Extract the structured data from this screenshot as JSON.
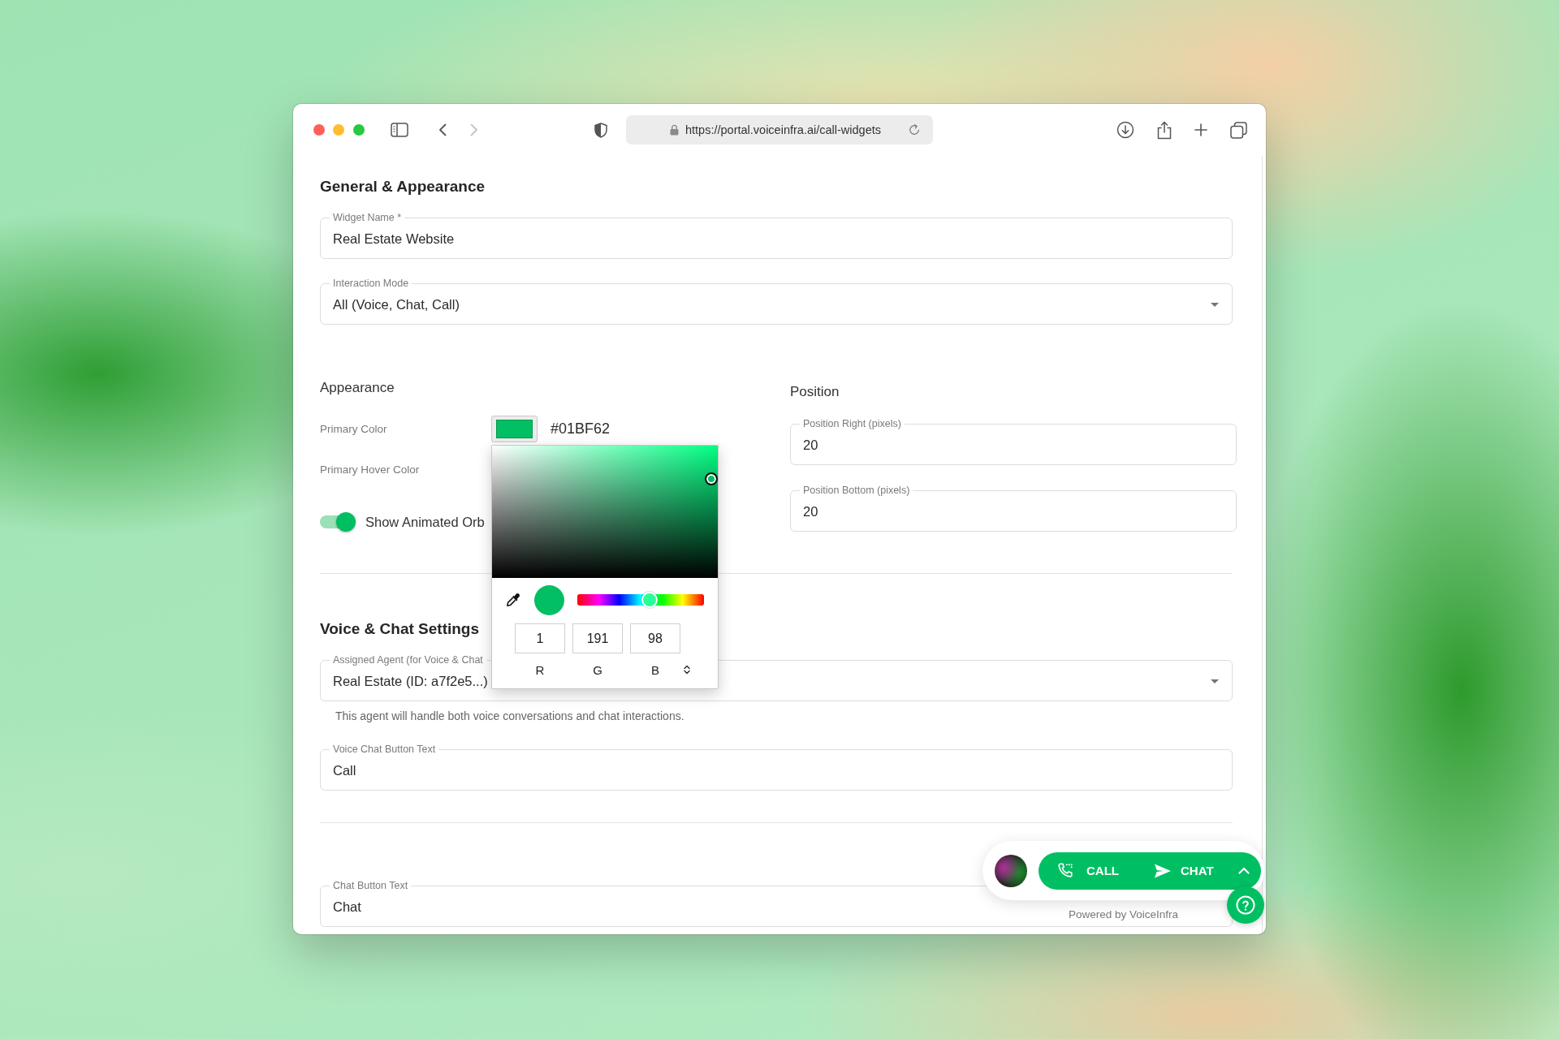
{
  "browser": {
    "url": "https://portal.voiceinfra.ai/call-widgets",
    "nav": [
      {
        "kind": "back",
        "disabled": false
      },
      {
        "kind": "forward",
        "disabled": true
      }
    ]
  },
  "general": {
    "title": "General & Appearance",
    "fields": [
      {
        "kind": "text",
        "label": "Widget Name *",
        "value": "Real Estate Website"
      },
      {
        "kind": "select",
        "label": "Interaction Mode",
        "value": "All (Voice, Chat, Call)"
      }
    ]
  },
  "appearance": {
    "title": "Appearance",
    "colors": [
      {
        "label": "Primary Color",
        "value": "#01BF62",
        "color": "#01bf62"
      },
      {
        "label": "Primary Hover Color"
      }
    ],
    "toggle": {
      "label": "Show Animated Orb",
      "on": true
    }
  },
  "position": {
    "title": "Position",
    "fields": [
      {
        "kind": "text",
        "label": "Position Right (pixels)",
        "value": "20"
      },
      {
        "kind": "text",
        "label": "Position Bottom (pixels)",
        "value": "20"
      }
    ]
  },
  "color_picker": {
    "color": "#01bf62",
    "hue": {
      "level": 0.58
    },
    "channels": [
      {
        "label": "R",
        "value": "1"
      },
      {
        "label": "G",
        "value": "191"
      },
      {
        "label": "B",
        "value": "98"
      }
    ]
  },
  "voice_chat": {
    "title": "Voice & Chat Settings",
    "fields": [
      {
        "kind": "select",
        "label": "Assigned Agent (for Voice & Chat",
        "value": "Real Estate (ID: a7f2e5...)",
        "helper": "This agent will handle both voice conversations and chat interactions."
      },
      {
        "kind": "text",
        "label": "Voice Chat Button Text",
        "value": "Call"
      }
    ]
  },
  "chat": {
    "fields": [
      {
        "kind": "text",
        "label": "Chat Button Text",
        "value": "Chat"
      }
    ]
  },
  "widget": {
    "buttons": [
      {
        "kind": "call",
        "label": "CALL"
      },
      {
        "kind": "chat",
        "label": "CHAT"
      }
    ],
    "powered_by": "Powered by VoiceInfra"
  }
}
